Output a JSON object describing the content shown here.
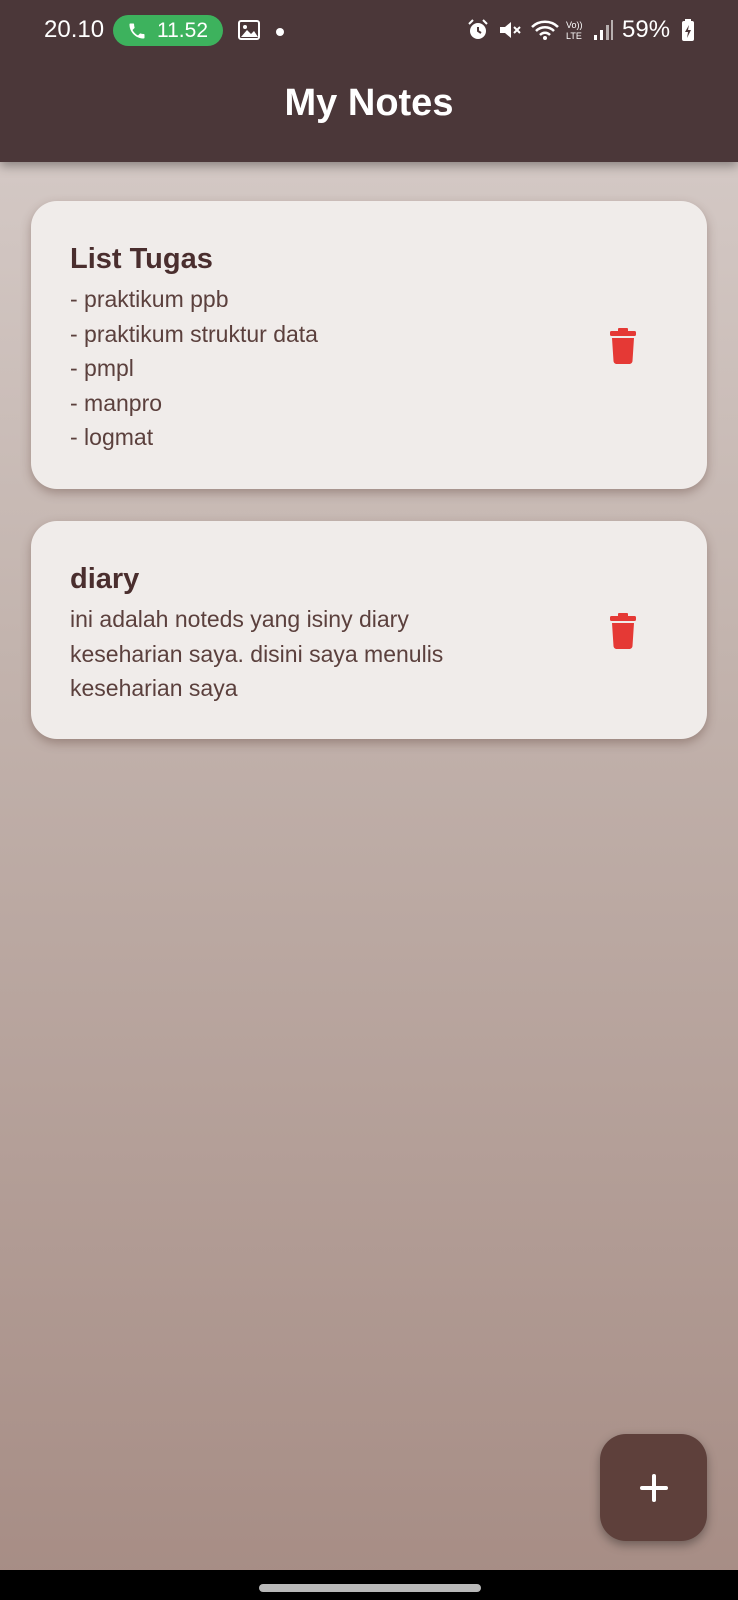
{
  "status_bar": {
    "time": "20.10",
    "call_time": "11.52",
    "battery": "59%",
    "icons": [
      "phone-icon",
      "gallery-icon",
      "dot-icon",
      "alarm-icon",
      "mute-icon",
      "wifi-icon",
      "volte-icon",
      "signal-icon",
      "battery-icon"
    ]
  },
  "app_bar": {
    "title": "My Notes"
  },
  "notes": [
    {
      "title": "List Tugas",
      "body": "- praktikum ppb\n- praktikum struktur data\n- pmpl\n- manpro\n- logmat"
    },
    {
      "title": "diary",
      "body": "ini adalah noteds yang isiny diary\nkeseharian saya. disini saya menulis\nkeseharian saya"
    }
  ],
  "colors": {
    "app_bar": "#4b3739",
    "card": "#f0ecea",
    "delete_icon": "#e53935",
    "fab": "#5e403b",
    "call_pill": "#3db25d"
  },
  "fab": {
    "icon": "plus-icon"
  }
}
